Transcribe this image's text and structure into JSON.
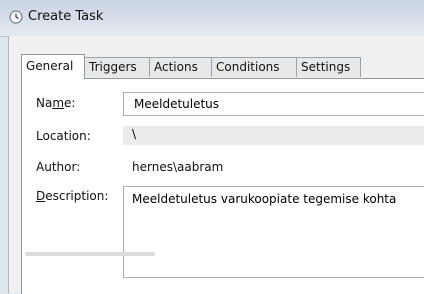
{
  "window": {
    "title": "Create Task",
    "icon": "task-scheduler-clock-icon"
  },
  "tabs": [
    {
      "label": "General",
      "active": true
    },
    {
      "label": "Triggers",
      "active": false
    },
    {
      "label": "Actions",
      "active": false
    },
    {
      "label": "Conditions",
      "active": false
    },
    {
      "label": "Settings",
      "active": false
    }
  ],
  "general": {
    "name_label_pre": "Na",
    "name_label_ul": "m",
    "name_label_post": "e:",
    "name_value": "Meeldetuletus",
    "location_label": "Location:",
    "location_value": "\\",
    "author_label": "Author:",
    "author_value": "hernes\\aabram",
    "description_label_ul": "D",
    "description_label_post": "escription:",
    "description_value": "Meeldetuletus varukoopiate tegemise kohta"
  }
}
